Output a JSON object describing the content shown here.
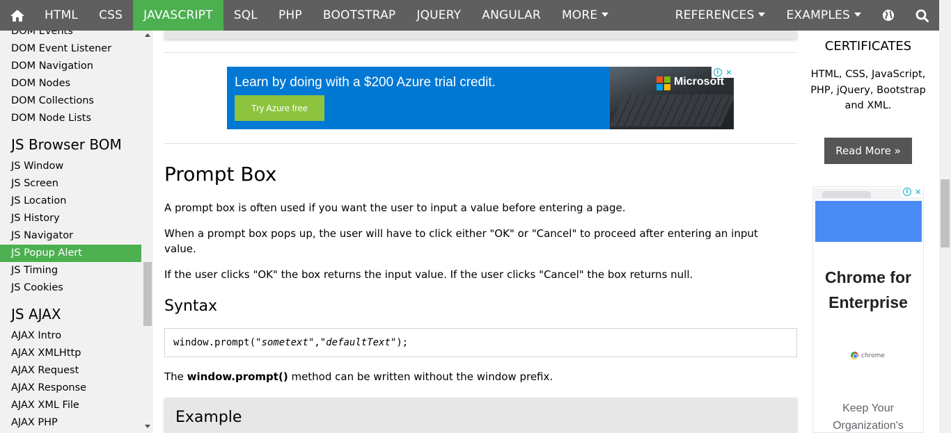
{
  "nav": {
    "home_icon": "home-icon",
    "items": [
      "HTML",
      "CSS",
      "JAVASCRIPT",
      "SQL",
      "PHP",
      "BOOTSTRAP",
      "JQUERY",
      "ANGULAR",
      "MORE"
    ],
    "right_items": [
      "REFERENCES",
      "EXAMPLES"
    ],
    "globe_icon": "globe-icon",
    "search_icon": "search-icon",
    "active_color": "#4CAF50",
    "bg_color": "#5f5f5f"
  },
  "sidebar": {
    "top_links": [
      "DOM Events",
      "DOM Event Listener",
      "DOM Navigation",
      "DOM Nodes",
      "DOM Collections",
      "DOM Node Lists"
    ],
    "bom_heading": "JS Browser BOM",
    "bom_links": [
      "JS Window",
      "JS Screen",
      "JS Location",
      "JS History",
      "JS Navigator",
      "JS Popup Alert",
      "JS Timing",
      "JS Cookies"
    ],
    "active_link": "JS Popup Alert",
    "ajax_heading": "JS AJAX",
    "ajax_links": [
      "AJAX Intro",
      "AJAX XMLHttp",
      "AJAX Request",
      "AJAX Response",
      "AJAX XML File",
      "AJAX PHP"
    ]
  },
  "ad_banner": {
    "headline": "Learn by doing with a $200 Azure trial credit.",
    "cta": "Try Azure free",
    "brand": "Microsoft",
    "bg_color": "#0078d4",
    "cta_color": "#8cc43f"
  },
  "content": {
    "title": "Prompt Box",
    "p1": "A prompt box is often used if you want the user to input a value before entering a page.",
    "p2": "When a prompt box pops up, the user will have to click either \"OK\" or \"Cancel\" to proceed after entering an input value.",
    "p3": "If the user clicks \"OK\" the box returns the input value. If the user clicks \"Cancel\" the box returns null.",
    "syntax_heading": "Syntax",
    "code_prefix": "window.prompt(\"",
    "code_arg1": "sometext",
    "code_mid": "\",\"",
    "code_arg2": "defaultText",
    "code_suffix": "\");",
    "p4_pre": "The ",
    "p4_bold": "window.prompt()",
    "p4_post": " method can be written without the window prefix.",
    "example_heading": "Example"
  },
  "right": {
    "title": "CERTIFICATES",
    "text": "HTML, CSS, JavaScript, PHP, jQuery, Bootstrap and XML.",
    "button": "Read More »"
  },
  "ad_side": {
    "headline": "Chrome for Enterprise",
    "brand": "chrome",
    "sub": "Keep Your Organization's"
  }
}
